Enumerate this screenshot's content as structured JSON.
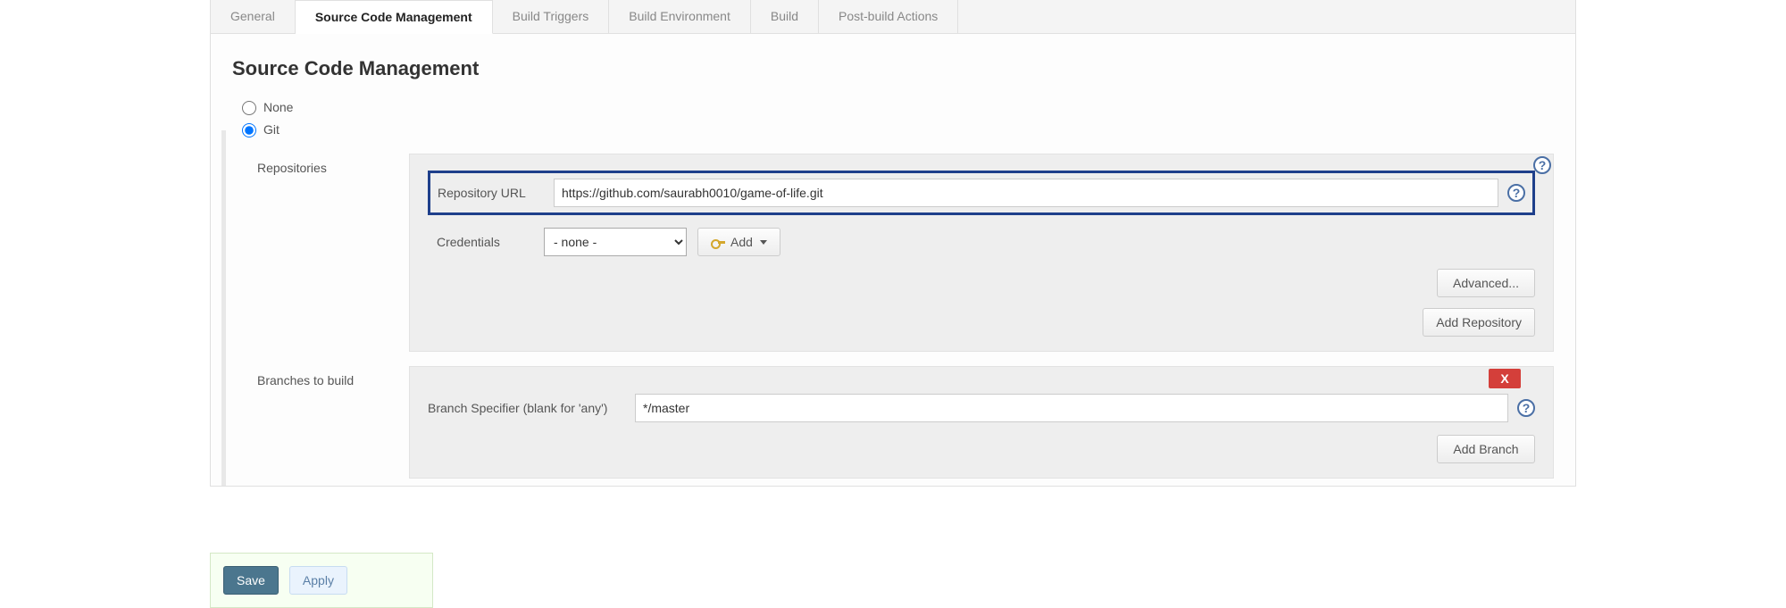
{
  "tabs": {
    "general": "General",
    "scm": "Source Code Management",
    "build_triggers": "Build Triggers",
    "build_env": "Build Environment",
    "build": "Build",
    "post_build": "Post-build Actions"
  },
  "section": {
    "title": "Source Code Management"
  },
  "scm_options": {
    "none": {
      "label": "None",
      "selected": false
    },
    "git": {
      "label": "Git",
      "selected": true
    }
  },
  "repositories": {
    "label": "Repositories",
    "repo_url_label": "Repository URL",
    "repo_url_value": "https://github.com/saurabh0010/game-of-life.git",
    "credentials_label": "Credentials",
    "credentials_selected": "- none -",
    "add_credential_label": "Add",
    "advanced_button": "Advanced...",
    "add_repo_button": "Add Repository"
  },
  "branches": {
    "label": "Branches to build",
    "specifier_label": "Branch Specifier (blank for 'any')",
    "specifier_value": "*/master",
    "remove_label": "X",
    "add_branch_button": "Add Branch"
  },
  "footer": {
    "save": "Save",
    "apply": "Apply"
  },
  "help_glyph": "?"
}
